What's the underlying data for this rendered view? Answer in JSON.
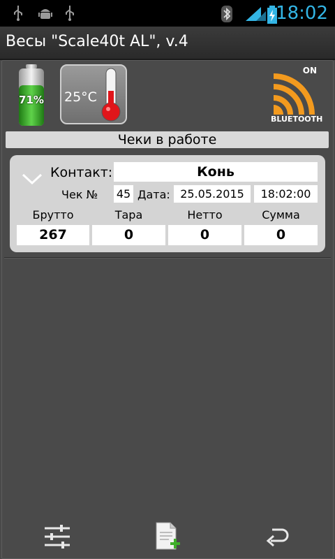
{
  "status_bar": {
    "time": "18:02",
    "icons": [
      "usb-icon",
      "android-debug-icon",
      "usb-icon",
      "bluetooth-icon",
      "wifi-icon",
      "signal-icon",
      "battery-charging-icon"
    ]
  },
  "app": {
    "title": "Весы \"Scale40t AL\", v.4"
  },
  "indicators": {
    "battery": {
      "label": "71%",
      "level": 0.71
    },
    "temperature": {
      "label": "25°C"
    },
    "bluetooth": {
      "state": "ON",
      "label": "BLUETOOTH"
    }
  },
  "section": {
    "title": "Чеки в работе"
  },
  "check": {
    "contact_label": "Контакт:",
    "contact_value": "Конь",
    "number_label": "Чек №",
    "number_value": "45",
    "date_label": "Дата:",
    "date_value": "25.05.2015",
    "time_value": "18:02:00",
    "gross_label": "Брутто",
    "tare_label": "Тара",
    "net_label": "Нетто",
    "sum_label": "Сумма",
    "gross_value": "267",
    "tare_value": "0",
    "net_value": "0",
    "sum_value": "0"
  },
  "colors": {
    "accent": "#33b5e5",
    "bluetooth_orange": "#f39a1e",
    "battery_green": "#3fae2a",
    "thermo_red": "#e0151a"
  }
}
